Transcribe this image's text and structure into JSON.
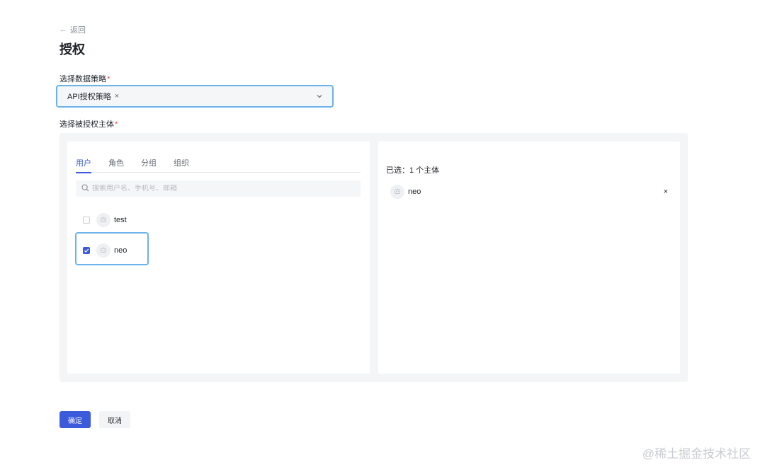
{
  "nav": {
    "back_label": "返回"
  },
  "page": {
    "title": "授权"
  },
  "policy": {
    "label": "选择数据策略",
    "required_mark": "*",
    "selected_tag": "API授权策略",
    "tag_remove": "×"
  },
  "subject": {
    "label": "选择被授权主体",
    "required_mark": "*",
    "tabs": [
      {
        "label": "用户",
        "active": true
      },
      {
        "label": "角色",
        "active": false
      },
      {
        "label": "分组",
        "active": false
      },
      {
        "label": "组织",
        "active": false
      }
    ],
    "search": {
      "placeholder": "搜索用户名、手机号、邮箱",
      "value": ""
    },
    "users": [
      {
        "name": "test",
        "checked": false
      },
      {
        "name": "neo",
        "checked": true
      }
    ],
    "selected_summary": "已选：1 个主体",
    "selected": [
      {
        "name": "neo",
        "remove": "×"
      }
    ]
  },
  "actions": {
    "confirm": "确定",
    "cancel": "取消"
  },
  "watermark": "@稀土掘金技术社区",
  "colors": {
    "accent": "#3b5bdb",
    "focus": "#6db2ea",
    "required": "#f54a45"
  }
}
